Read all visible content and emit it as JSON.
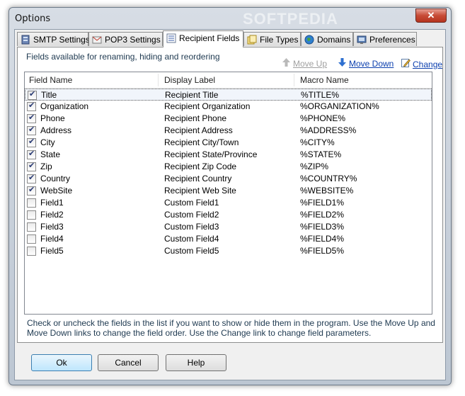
{
  "window": {
    "title": "Options",
    "close_glyph": "✕"
  },
  "watermark": "SOFTPEDIA",
  "tabs": [
    {
      "label": "SMTP Settings",
      "icon": "server-icon",
      "active": false
    },
    {
      "label": "POP3 Settings",
      "icon": "mail-icon",
      "active": false
    },
    {
      "label": "Recipient Fields",
      "icon": "fields-list-icon",
      "active": true
    },
    {
      "label": "File Types",
      "icon": "file-types-icon",
      "active": false
    },
    {
      "label": "Domains",
      "icon": "globe-icon",
      "active": false
    },
    {
      "label": "Preferences",
      "icon": "preferences-icon",
      "active": false
    }
  ],
  "panel": {
    "fields_label": "Fields available for renaming, hiding and reordering",
    "actions": {
      "move_up": "Move Up",
      "move_down": "Move Down",
      "change": "Change"
    },
    "columns": [
      "Field Name",
      "Display Label",
      "Macro Name"
    ],
    "rows": [
      {
        "checked": true,
        "name": "Title",
        "label": "Recipient Title",
        "macro": "%TITLE%",
        "selected": true
      },
      {
        "checked": true,
        "name": "Organization",
        "label": "Recipient Organization",
        "macro": "%ORGANIZATION%"
      },
      {
        "checked": true,
        "name": "Phone",
        "label": "Recipient Phone",
        "macro": "%PHONE%"
      },
      {
        "checked": true,
        "name": "Address",
        "label": "Recipient Address",
        "macro": "%ADDRESS%"
      },
      {
        "checked": true,
        "name": "City",
        "label": "Recipient City/Town",
        "macro": "%CITY%"
      },
      {
        "checked": true,
        "name": "State",
        "label": "Recipient State/Province",
        "macro": "%STATE%"
      },
      {
        "checked": true,
        "name": "Zip",
        "label": "Recipient Zip Code",
        "macro": "%ZIP%"
      },
      {
        "checked": true,
        "name": "Country",
        "label": "Recipient Country",
        "macro": "%COUNTRY%"
      },
      {
        "checked": true,
        "name": "WebSite",
        "label": "Recipient Web Site",
        "macro": "%WEBSITE%"
      },
      {
        "checked": false,
        "name": "Field1",
        "label": "Custom Field1",
        "macro": "%FIELD1%"
      },
      {
        "checked": false,
        "name": "Field2",
        "label": "Custom Field2",
        "macro": "%FIELD2%"
      },
      {
        "checked": false,
        "name": "Field3",
        "label": "Custom Field3",
        "macro": "%FIELD3%"
      },
      {
        "checked": false,
        "name": "Field4",
        "label": "Custom Field4",
        "macro": "%FIELD4%"
      },
      {
        "checked": false,
        "name": "Field5",
        "label": "Custom Field5",
        "macro": "%FIELD5%"
      }
    ],
    "help_text": "Check or uncheck the fields in the list if you want to show or hide them in the program. Use the Move Up and Move Down links to change the field order. Use the Change link to change field parameters."
  },
  "buttons": {
    "ok": "Ok",
    "cancel": "Cancel",
    "help": "Help"
  }
}
